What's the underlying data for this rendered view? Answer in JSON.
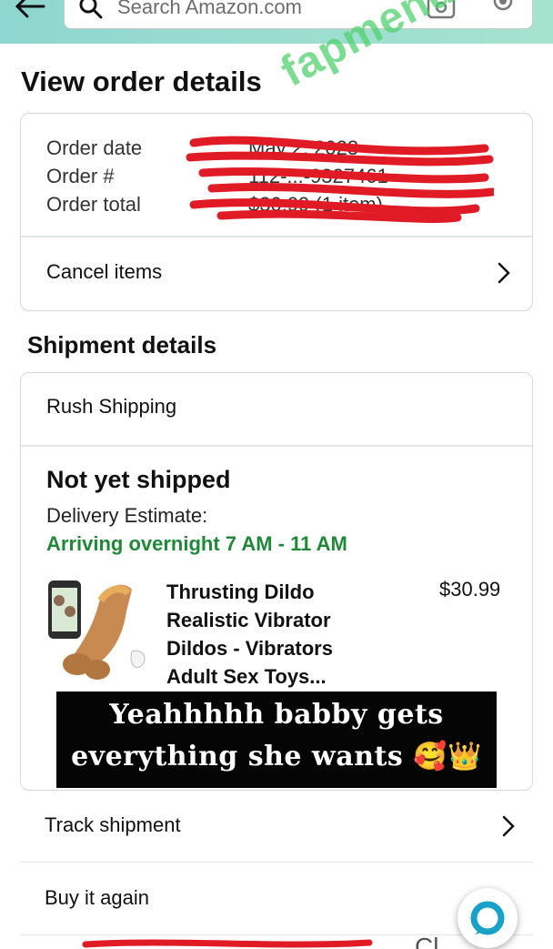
{
  "header": {
    "search_placeholder": "Search Amazon.com"
  },
  "page": {
    "title": "View order details"
  },
  "order": {
    "labels": [
      "Order date",
      "Order #",
      "Order total"
    ],
    "values": [
      "May 2, 2023",
      "112-...-9327461",
      "$30.99 (1 item)"
    ],
    "cancel_label": "Cancel items"
  },
  "shipment": {
    "heading": "Shipment details",
    "shipping_speed": "Rush Shipping",
    "status": "Not yet shipped",
    "estimate_label": "Delivery Estimate:",
    "arriving": "Arriving overnight 7 AM - 11 AM",
    "arriving_color": "#218839",
    "product": {
      "title_lines": [
        "Thrusting Dildo",
        "Realistic Vibrator",
        "Dildos - Vibrators",
        "Adult Sex Toys..."
      ],
      "price": "$30.99"
    }
  },
  "overlay": {
    "line1": "Yeahhhhh babby gets",
    "line2": "everything she wants 🥰👑"
  },
  "actions": {
    "track_label": "Track shipment",
    "buy_again_label": "Buy it again"
  },
  "watermark": "fapmenu.com",
  "bottom_partial_text": "Cl..."
}
